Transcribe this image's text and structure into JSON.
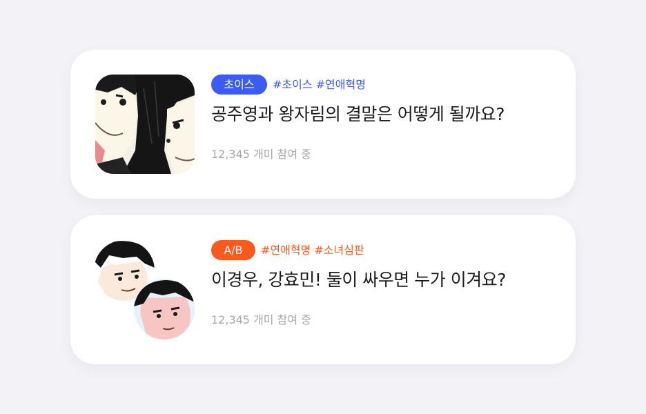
{
  "cards": [
    {
      "badge": "초이스",
      "hashtags": "#초이스 #연애혁명",
      "title": "공주영과 왕자림의 결말은 어떻게 될까요?",
      "participants": "12,345 개미 참여 중",
      "accent": "#3b5bf3",
      "thumbnail": "comic-couple-thumbnail"
    },
    {
      "badge": "A/B",
      "hashtags": "#연애혁명 #소녀심판",
      "title": "이경우, 강효민! 둘이 싸우면 누가 이겨요?",
      "participants": "12,345 개미 참여 중",
      "accent": "#fb5a1f",
      "thumbnail": "two-character-avatars"
    }
  ],
  "colors": {
    "background": "#f3f3f7",
    "card": "#ffffff",
    "title": "#1b1b1f",
    "meta": "#a3a6ae"
  }
}
